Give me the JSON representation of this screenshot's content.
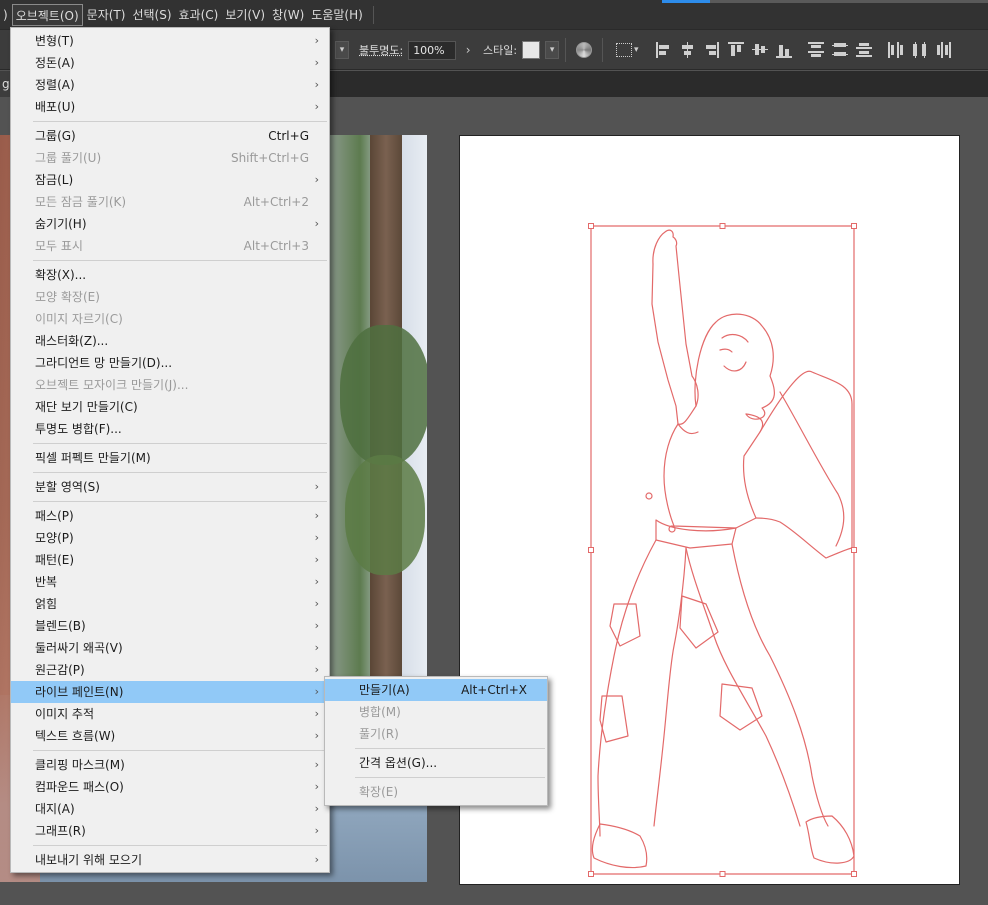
{
  "menubar": {
    "items": [
      {
        "label": ")",
        "active": false
      },
      {
        "label": "오브젝트(O)",
        "active": true
      },
      {
        "label": "문자(T)",
        "active": false
      },
      {
        "label": "선택(S)",
        "active": false
      },
      {
        "label": "효과(C)",
        "active": false
      },
      {
        "label": "보기(V)",
        "active": false
      },
      {
        "label": "창(W)",
        "active": false
      },
      {
        "label": "도움말(H)",
        "active": false
      }
    ]
  },
  "controlbar": {
    "opacity_label": "불투명도:",
    "opacity_value": "100%",
    "style_label": "스타일:"
  },
  "document": {
    "tab_label": "g.a"
  },
  "object_menu": {
    "items": [
      {
        "type": "item",
        "name": "transform",
        "label": "변형(T)",
        "shortcut": "",
        "submenu": true,
        "disabled": false
      },
      {
        "type": "item",
        "name": "arrange",
        "label": "정돈(A)",
        "shortcut": "",
        "submenu": true,
        "disabled": false
      },
      {
        "type": "item",
        "name": "align",
        "label": "정렬(A)",
        "shortcut": "",
        "submenu": true,
        "disabled": false
      },
      {
        "type": "item",
        "name": "distribute",
        "label": "배포(U)",
        "shortcut": "",
        "submenu": true,
        "disabled": false
      },
      {
        "type": "sep"
      },
      {
        "type": "item",
        "name": "group",
        "label": "그룹(G)",
        "shortcut": "Ctrl+G",
        "submenu": false,
        "disabled": false
      },
      {
        "type": "item",
        "name": "ungroup",
        "label": "그룹 풀기(U)",
        "shortcut": "Shift+Ctrl+G",
        "submenu": false,
        "disabled": true
      },
      {
        "type": "item",
        "name": "lock",
        "label": "잠금(L)",
        "shortcut": "",
        "submenu": true,
        "disabled": false
      },
      {
        "type": "item",
        "name": "unlock-all",
        "label": "모든 잠금 풀기(K)",
        "shortcut": "Alt+Ctrl+2",
        "submenu": false,
        "disabled": true
      },
      {
        "type": "item",
        "name": "hide",
        "label": "숨기기(H)",
        "shortcut": "",
        "submenu": true,
        "disabled": false
      },
      {
        "type": "item",
        "name": "show-all",
        "label": "모두 표시",
        "shortcut": "Alt+Ctrl+3",
        "submenu": false,
        "disabled": true
      },
      {
        "type": "sep"
      },
      {
        "type": "item",
        "name": "expand",
        "label": "확장(X)...",
        "shortcut": "",
        "submenu": false,
        "disabled": false
      },
      {
        "type": "item",
        "name": "expand-appearance",
        "label": "모양 확장(E)",
        "shortcut": "",
        "submenu": false,
        "disabled": true
      },
      {
        "type": "item",
        "name": "crop-image",
        "label": "이미지 자르기(C)",
        "shortcut": "",
        "submenu": false,
        "disabled": true
      },
      {
        "type": "item",
        "name": "rasterize",
        "label": "래스터화(Z)...",
        "shortcut": "",
        "submenu": false,
        "disabled": false
      },
      {
        "type": "item",
        "name": "gradient-mesh",
        "label": "그라디언트 망 만들기(D)...",
        "shortcut": "",
        "submenu": false,
        "disabled": false
      },
      {
        "type": "item",
        "name": "object-mosaic",
        "label": "오브젝트 모자이크 만들기(J)...",
        "shortcut": "",
        "submenu": false,
        "disabled": true
      },
      {
        "type": "item",
        "name": "trim-marks",
        "label": "재단 보기 만들기(C)",
        "shortcut": "",
        "submenu": false,
        "disabled": false
      },
      {
        "type": "item",
        "name": "flatten-transparency",
        "label": "투명도 병합(F)...",
        "shortcut": "",
        "submenu": false,
        "disabled": false
      },
      {
        "type": "sep"
      },
      {
        "type": "item",
        "name": "pixel-perfect",
        "label": "픽셀 퍼펙트 만들기(M)",
        "shortcut": "",
        "submenu": false,
        "disabled": false
      },
      {
        "type": "sep"
      },
      {
        "type": "item",
        "name": "slice",
        "label": "분할 영역(S)",
        "shortcut": "",
        "submenu": true,
        "disabled": false
      },
      {
        "type": "sep"
      },
      {
        "type": "item",
        "name": "path",
        "label": "패스(P)",
        "shortcut": "",
        "submenu": true,
        "disabled": false
      },
      {
        "type": "item",
        "name": "shape",
        "label": "모양(P)",
        "shortcut": "",
        "submenu": true,
        "disabled": false
      },
      {
        "type": "item",
        "name": "pattern",
        "label": "패턴(E)",
        "shortcut": "",
        "submenu": true,
        "disabled": false
      },
      {
        "type": "item",
        "name": "repeat",
        "label": "반복",
        "shortcut": "",
        "submenu": true,
        "disabled": false
      },
      {
        "type": "item",
        "name": "intertwine",
        "label": "얽힘",
        "shortcut": "",
        "submenu": true,
        "disabled": false
      },
      {
        "type": "item",
        "name": "blend",
        "label": "블렌드(B)",
        "shortcut": "",
        "submenu": true,
        "disabled": false
      },
      {
        "type": "item",
        "name": "envelope-distort",
        "label": "둘러싸기 왜곡(V)",
        "shortcut": "",
        "submenu": true,
        "disabled": false
      },
      {
        "type": "item",
        "name": "perspective",
        "label": "원근감(P)",
        "shortcut": "",
        "submenu": true,
        "disabled": false
      },
      {
        "type": "item",
        "name": "live-paint",
        "label": "라이브 페인트(N)",
        "shortcut": "",
        "submenu": true,
        "disabled": false,
        "highlighted": true
      },
      {
        "type": "item",
        "name": "image-trace",
        "label": "이미지 추적",
        "shortcut": "",
        "submenu": true,
        "disabled": false
      },
      {
        "type": "item",
        "name": "text-wrap",
        "label": "텍스트 흐름(W)",
        "shortcut": "",
        "submenu": true,
        "disabled": false
      },
      {
        "type": "sep"
      },
      {
        "type": "item",
        "name": "clipping-mask",
        "label": "클리핑 마스크(M)",
        "shortcut": "",
        "submenu": true,
        "disabled": false
      },
      {
        "type": "item",
        "name": "compound-path",
        "label": "컴파운드 패스(O)",
        "shortcut": "",
        "submenu": true,
        "disabled": false
      },
      {
        "type": "item",
        "name": "artboards",
        "label": "대지(A)",
        "shortcut": "",
        "submenu": true,
        "disabled": false
      },
      {
        "type": "item",
        "name": "graph",
        "label": "그래프(R)",
        "shortcut": "",
        "submenu": true,
        "disabled": false
      },
      {
        "type": "sep"
      },
      {
        "type": "item",
        "name": "collect-for-export",
        "label": "내보내기 위해 모으기",
        "shortcut": "",
        "submenu": true,
        "disabled": false
      }
    ]
  },
  "live_paint_submenu": {
    "items": [
      {
        "type": "item",
        "name": "make",
        "label": "만들기(A)",
        "shortcut": "Alt+Ctrl+X",
        "disabled": false,
        "highlighted": true
      },
      {
        "type": "item",
        "name": "merge",
        "label": "병합(M)",
        "shortcut": "",
        "disabled": true
      },
      {
        "type": "item",
        "name": "release",
        "label": "풀기(R)",
        "shortcut": "",
        "disabled": true
      },
      {
        "type": "sep"
      },
      {
        "type": "item",
        "name": "gap-options",
        "label": "간격 옵션(G)...",
        "shortcut": "",
        "disabled": false
      },
      {
        "type": "sep"
      },
      {
        "type": "item",
        "name": "expand",
        "label": "확장(E)",
        "shortcut": "",
        "disabled": true
      }
    ]
  },
  "colors": {
    "menubar_bg": "#323232",
    "control_bg": "#3c3c3c",
    "workspace_bg": "#535353",
    "menu_bg": "#f0f0f0",
    "menu_highlight": "#91c9f7",
    "selection_red": "#e36a6a",
    "accent_blue": "#2d8ceb"
  }
}
